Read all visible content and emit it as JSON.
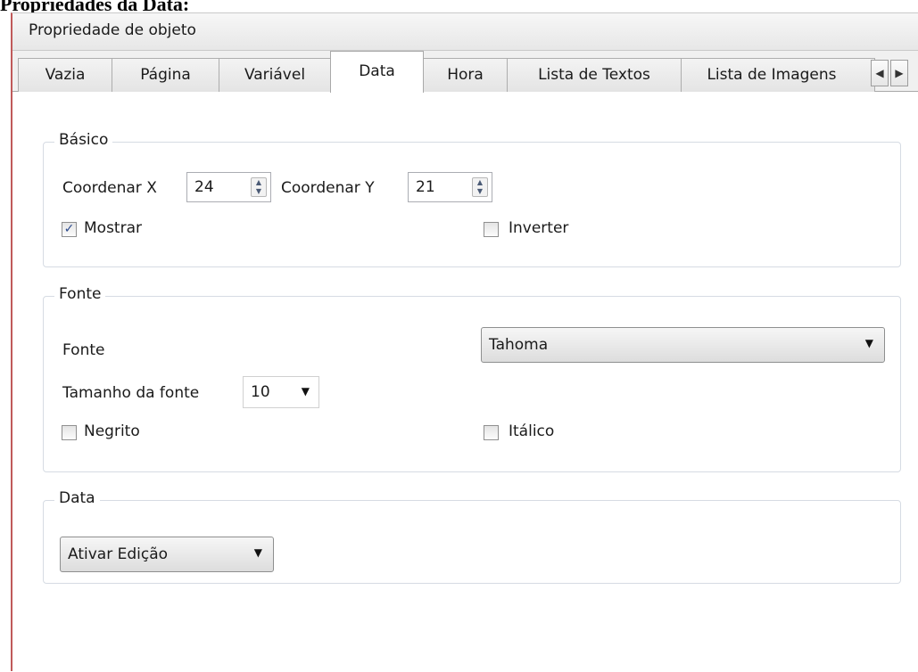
{
  "doc_heading": "Propriedades da Data:",
  "window": {
    "title": "Propriedade de objeto"
  },
  "tabs": [
    {
      "label": "Vazia"
    },
    {
      "label": "Página"
    },
    {
      "label": "Variável"
    },
    {
      "label": "Data",
      "active": true
    },
    {
      "label": "Hora"
    },
    {
      "label": "Lista de Textos"
    },
    {
      "label": "Lista de Imagens"
    }
  ],
  "tab_scroll": {
    "left_icon": "scroll-left-icon",
    "right_icon": "scroll-right-icon"
  },
  "basico": {
    "title": "Básico",
    "coord_x_label": "Coordenar X",
    "coord_x_value": "24",
    "coord_y_label": "Coordenar Y",
    "coord_y_value": "21",
    "mostrar_label": "Mostrar",
    "mostrar_checked": true,
    "inverter_label": "Inverter",
    "inverter_checked": false
  },
  "fonte": {
    "title": "Fonte",
    "fonte_label": "Fonte",
    "fonte_value": "Tahoma",
    "tamanho_label": "Tamanho da fonte",
    "tamanho_value": "10",
    "negrito_label": "Negrito",
    "negrito_checked": false,
    "italico_label": "Itálico",
    "italico_checked": false
  },
  "data_group": {
    "title": "Data",
    "mode_value": "Ativar Edição"
  }
}
